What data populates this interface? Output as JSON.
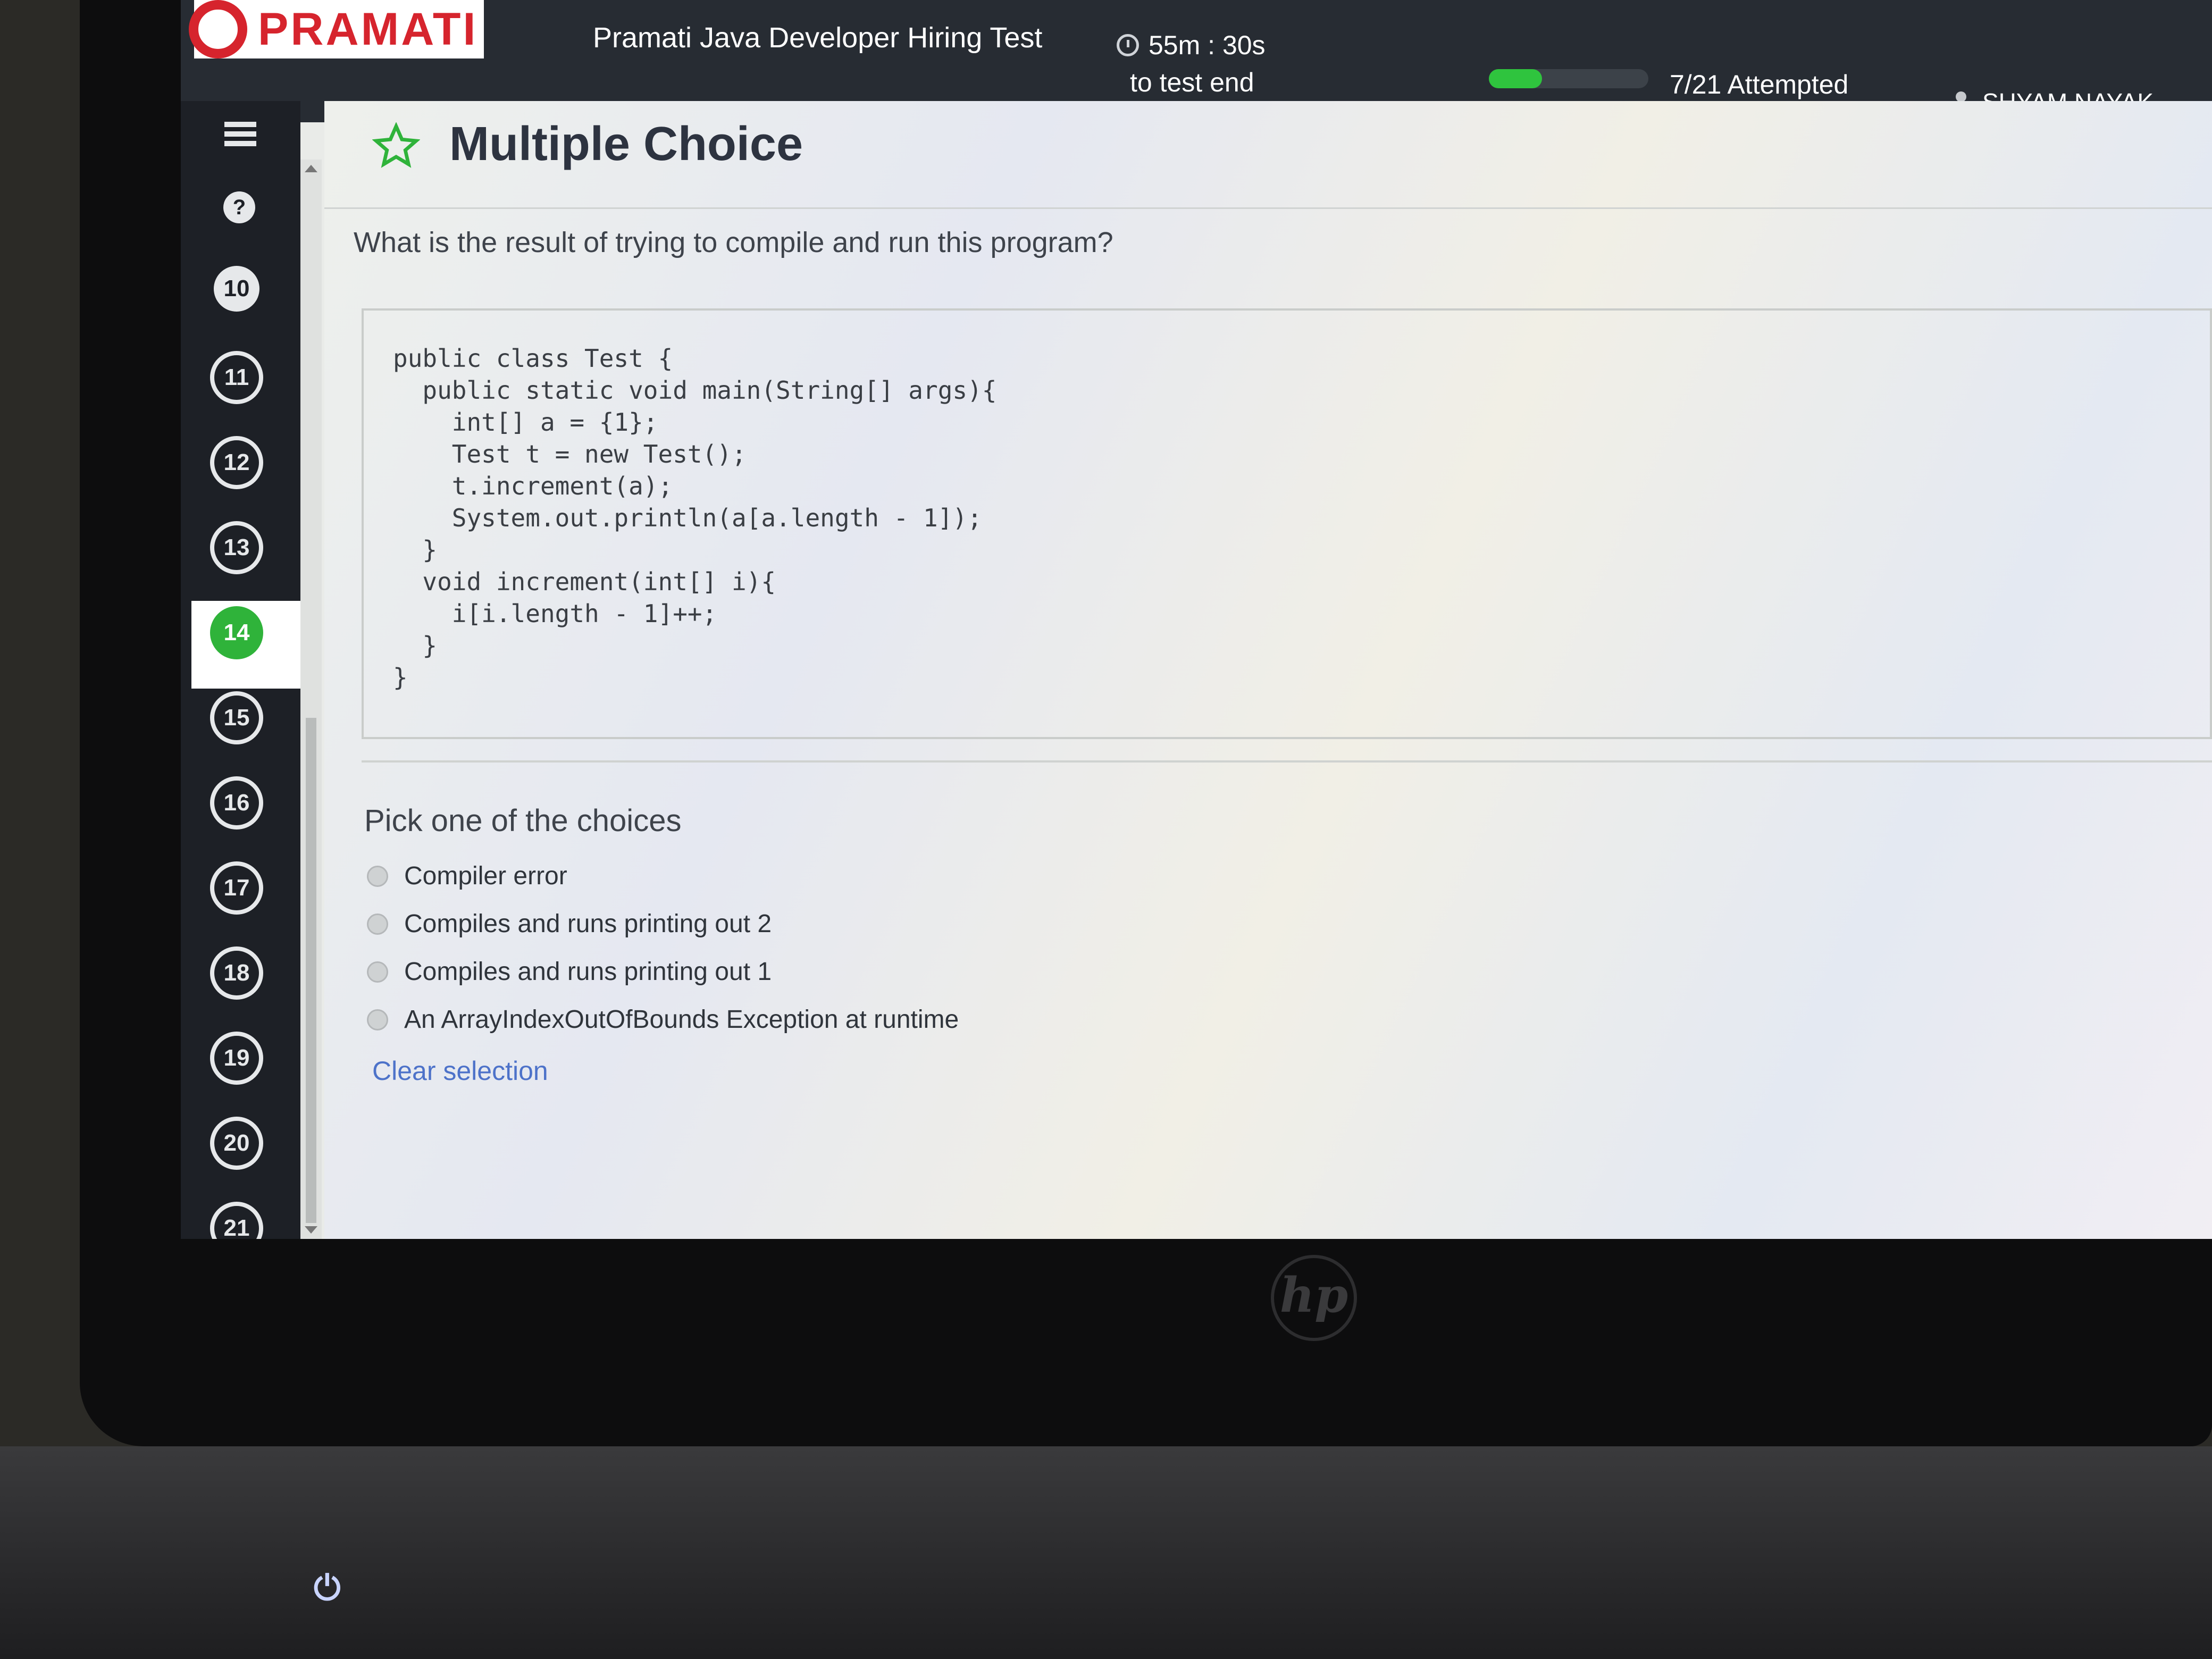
{
  "brand": {
    "logo_text": "PRAMATI"
  },
  "header": {
    "test_title": "Pramati Java Developer Hiring Test",
    "timer": "55m : 30s",
    "timer_sub": "to test end",
    "attempted": "7/21 Attempted",
    "attempted_fraction": 0.333,
    "user_name": "SHYAM NAYAK"
  },
  "sidebar": {
    "help_label": "?",
    "questions": [
      "10",
      "11",
      "12",
      "13",
      "14",
      "15",
      "16",
      "17",
      "18",
      "19",
      "20",
      "21"
    ],
    "current_question": "14"
  },
  "question": {
    "type": "Multiple Choice",
    "prompt": "What is the result of trying to compile and run this program?",
    "code": "public class Test {\n  public static void main(String[] args){\n    int[] a = {1};\n    Test t = new Test();\n    t.increment(a);\n    System.out.println(a[a.length - 1]);\n  }\n  void increment(int[] i){\n    i[i.length - 1]++;\n  }\n}"
  },
  "choices": {
    "heading": "Pick one of the choices",
    "options": [
      "Compiler error",
      "Compiles and runs printing out 2",
      "Compiles and runs printing out 1",
      "An ArrayIndexOutOfBounds Exception at runtime"
    ],
    "clear_label": "Clear selection"
  },
  "hardware": {
    "brand_text": "hp",
    "power_icon": "power-icon"
  },
  "colors": {
    "accent_green": "#2fb33a",
    "brand_red": "#d6242d",
    "link_blue": "#4d72c9",
    "topbar": "#272c33"
  }
}
